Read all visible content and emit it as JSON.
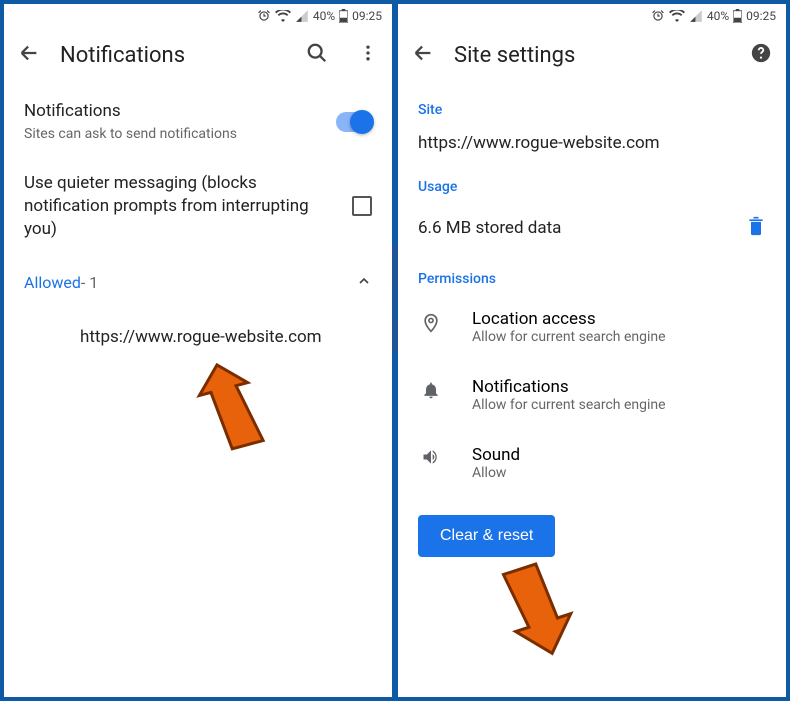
{
  "status": {
    "battery_pct": "40%",
    "time": "09:25"
  },
  "left": {
    "title": "Notifications",
    "notif": {
      "title": "Notifications",
      "sub": "Sites can ask to send notifications"
    },
    "quieter": "Use quieter messaging (blocks notification prompts from interrupting you)",
    "allowed_label": "Allowed",
    "allowed_count": " - 1",
    "site_url": "https://www.rogue-website.com"
  },
  "right": {
    "title": "Site settings",
    "sections": {
      "site": "Site",
      "usage": "Usage",
      "permissions": "Permissions"
    },
    "site_url": "https://www.rogue-website.com",
    "stored": "6.6 MB stored data",
    "perms": {
      "location": {
        "title": "Location access",
        "sub": "Allow for current search engine"
      },
      "notifications": {
        "title": "Notifications",
        "sub": "Allow for current search engine"
      },
      "sound": {
        "title": "Sound",
        "sub": "Allow"
      }
    },
    "clear_btn": "Clear & reset"
  }
}
